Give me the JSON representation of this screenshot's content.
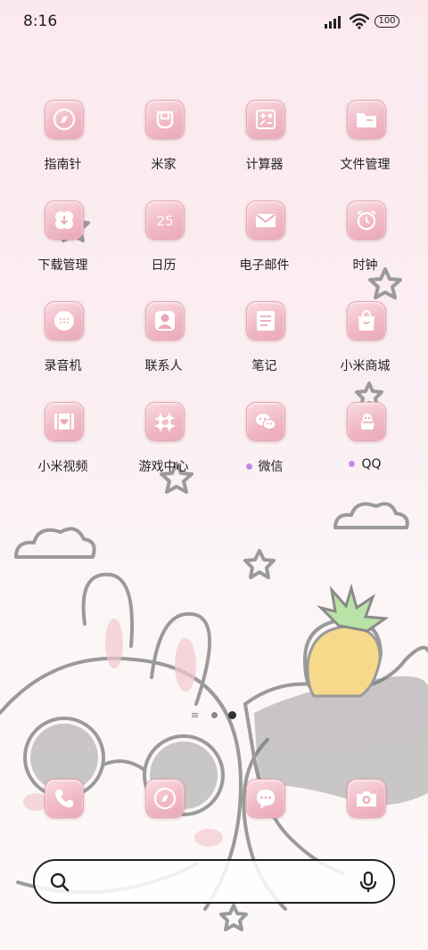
{
  "status_bar": {
    "time": "8:16",
    "battery": "100"
  },
  "apps": [
    {
      "label": "指南针",
      "icon": "compass-icon",
      "dot": false
    },
    {
      "label": "米家",
      "icon": "mijia-icon",
      "dot": false
    },
    {
      "label": "计算器",
      "icon": "calculator-icon",
      "dot": false
    },
    {
      "label": "文件管理",
      "icon": "folder-icon",
      "dot": false
    },
    {
      "label": "下载管理",
      "icon": "download-icon",
      "dot": false
    },
    {
      "label": "日历",
      "icon": "calendar-icon",
      "dot": false,
      "glyph": "25"
    },
    {
      "label": "电子邮件",
      "icon": "mail-icon",
      "dot": false
    },
    {
      "label": "时钟",
      "icon": "alarm-clock-icon",
      "dot": false
    },
    {
      "label": "录音机",
      "icon": "recorder-icon",
      "dot": false
    },
    {
      "label": "联系人",
      "icon": "contact-icon",
      "dot": false
    },
    {
      "label": "笔记",
      "icon": "notes-icon",
      "dot": false
    },
    {
      "label": "小米商城",
      "icon": "shopping-bag-icon",
      "dot": false
    },
    {
      "label": "小米视频",
      "icon": "video-icon",
      "dot": false
    },
    {
      "label": "游戏中心",
      "icon": "game-center-icon",
      "dot": false
    },
    {
      "label": "微信",
      "icon": "wechat-icon",
      "dot": true
    },
    {
      "label": "QQ",
      "icon": "qq-icon",
      "dot": true
    }
  ],
  "dock": [
    {
      "icon": "phone-icon"
    },
    {
      "icon": "browser-icon"
    },
    {
      "icon": "messages-icon"
    },
    {
      "icon": "camera-icon"
    }
  ],
  "search": {
    "placeholder": ""
  },
  "colors": {
    "icon_pink": "#f1b9c6",
    "text": "#222222",
    "notify_dot": "#c68ae6"
  }
}
